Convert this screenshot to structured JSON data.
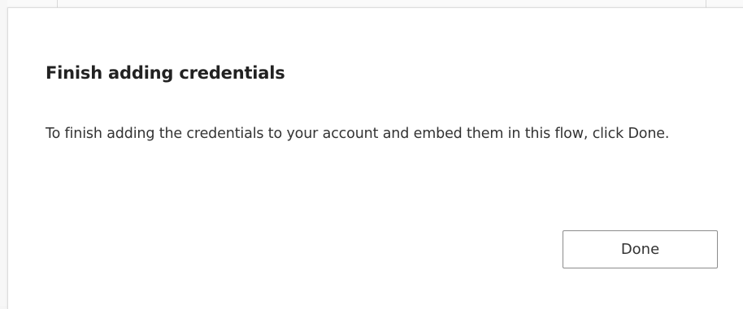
{
  "dialog": {
    "title": "Finish adding credentials",
    "message": "To finish adding the credentials to your account and embed them in this flow, click Done.",
    "done_label": "Done"
  }
}
